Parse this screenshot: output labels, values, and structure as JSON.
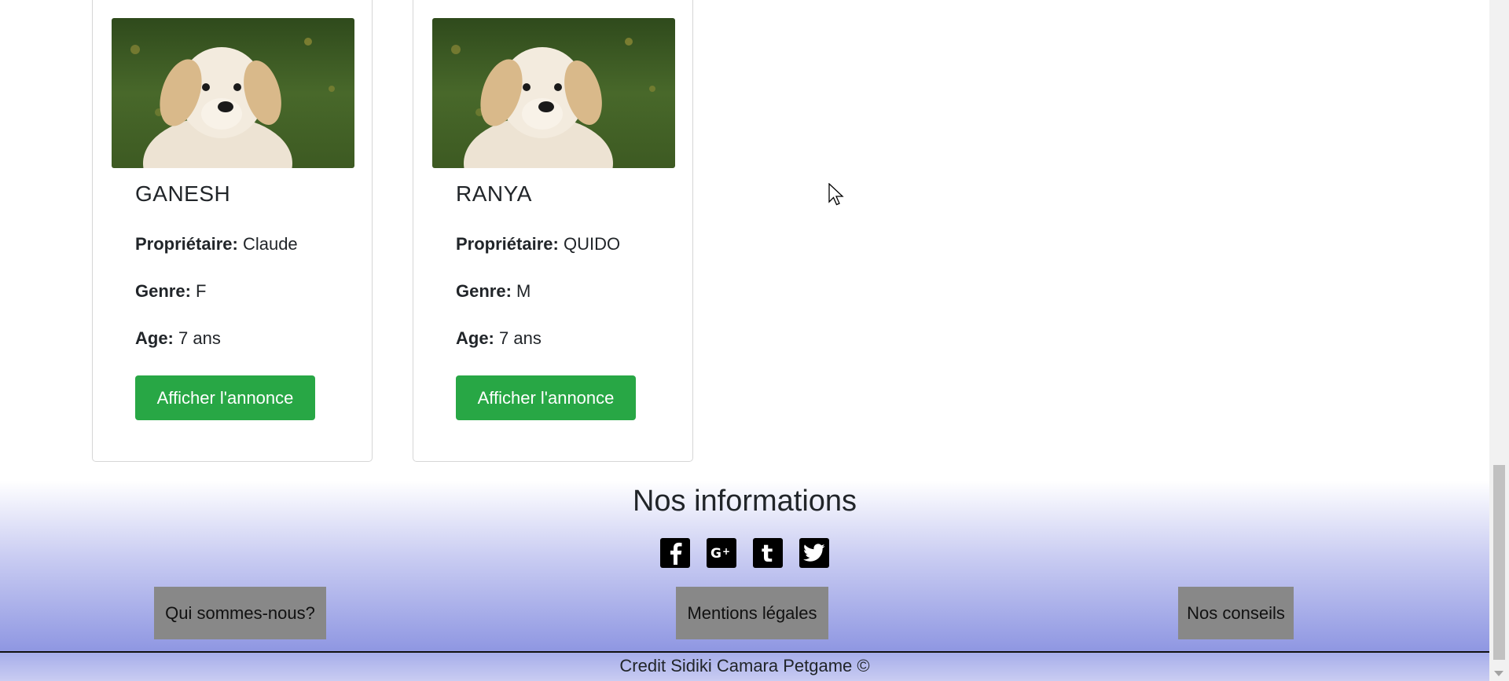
{
  "cards": [
    {
      "name": "GANESH",
      "owner_label": "Propriétaire:",
      "owner_value": "Claude",
      "genre_label": "Genre:",
      "genre_value": "F",
      "age_label": "Age:",
      "age_value": "7 ans",
      "button_label": "Afficher l'annonce"
    },
    {
      "name": "RANYA",
      "owner_label": "Propriétaire:",
      "owner_value": "QUIDO",
      "genre_label": "Genre:",
      "genre_value": "M",
      "age_label": "Age:",
      "age_value": "7 ans",
      "button_label": "Afficher l'annonce"
    }
  ],
  "footer": {
    "title": "Nos informations",
    "social_icons": [
      "facebook-icon",
      "google-plus-icon",
      "tumblr-icon",
      "twitter-icon"
    ],
    "buttons": [
      "Qui sommes-nous?",
      "Mentions légales",
      "Nos conseils"
    ],
    "credit": "Credit Sidiki Camara Petgame ©"
  },
  "colors": {
    "button_green": "#28a745",
    "info_button_gray": "#888888",
    "footer_gradient_bottom": "#8f97e2"
  }
}
